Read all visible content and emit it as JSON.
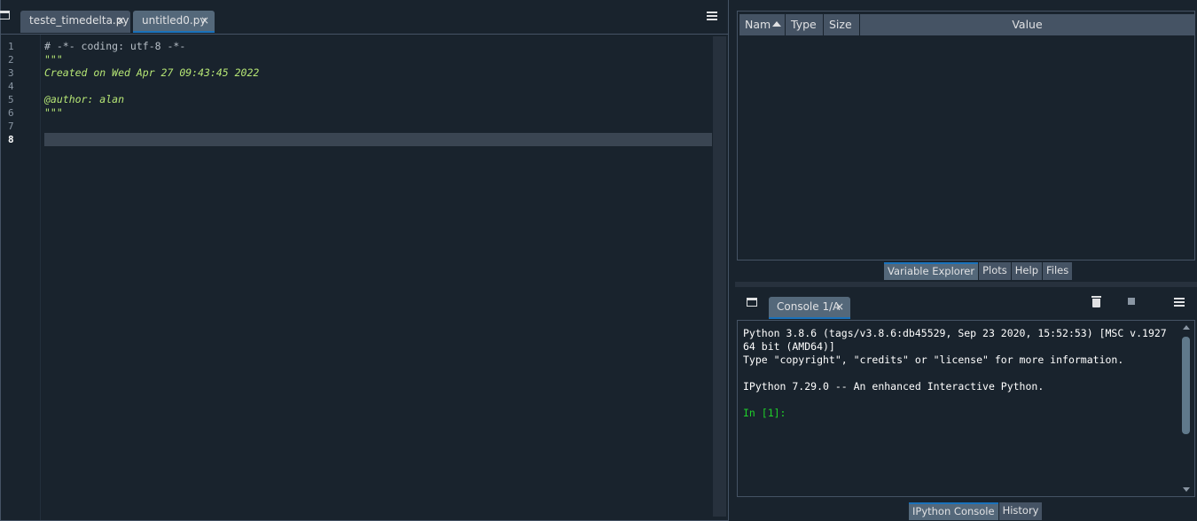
{
  "editor": {
    "tabs": [
      {
        "label": "teste_timedelta.py",
        "close": "×"
      },
      {
        "label": "untitled0.py",
        "close": "×"
      }
    ],
    "line_numbers": [
      "1",
      "2",
      "3",
      "4",
      "5",
      "6",
      "7",
      "8"
    ],
    "lines": [
      "# -*- coding: utf-8 -*-",
      "\"\"\"",
      "Created on Wed Apr 27 09:43:45 2022",
      "",
      "@author: alan",
      "\"\"\"",
      "",
      ""
    ]
  },
  "variable_explorer": {
    "columns": [
      "Nam",
      "Type",
      "Size",
      "Value"
    ],
    "tabs": [
      "Variable Explorer",
      "Plots",
      "Help",
      "Files"
    ]
  },
  "console": {
    "tab_label": "Console 1/A",
    "tab_close": "×",
    "output": [
      "Python 3.8.6 (tags/v3.8.6:db45529, Sep 23 2020, 15:52:53) [MSC v.1927",
      "64 bit (AMD64)]",
      "Type \"copyright\", \"credits\" or \"license\" for more information.",
      "",
      "IPython 7.29.0 -- An enhanced Interactive Python.",
      "",
      "In [1]:"
    ],
    "tabs": [
      "IPython Console",
      "History"
    ]
  },
  "colors": {
    "background": "#19232d",
    "tab": "#455364",
    "tab_active": "#54687a",
    "accent": "#1a72bb",
    "docstring": "#b6e675",
    "prompt": "#1fd12a"
  }
}
